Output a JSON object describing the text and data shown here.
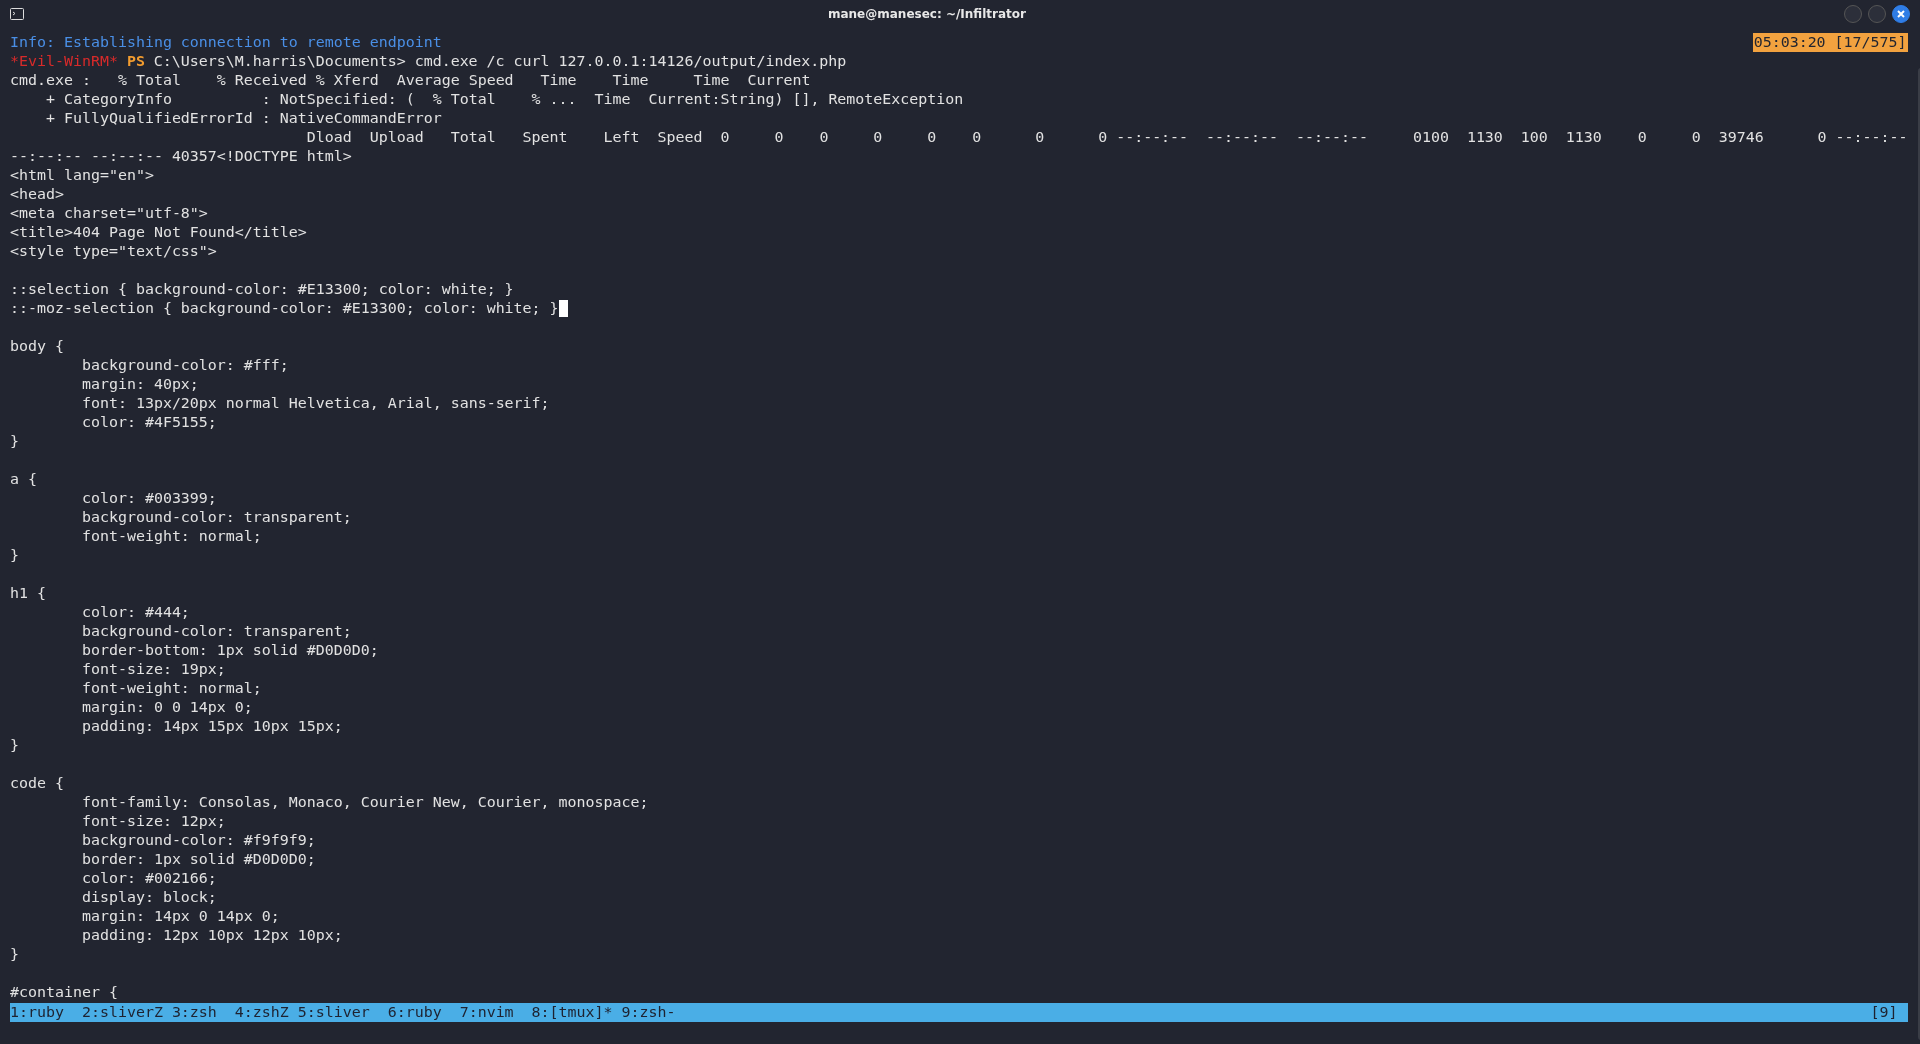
{
  "window": {
    "title": "mane@manesec: ~/Infiltrator"
  },
  "clock": "05:03:20 [17/575]",
  "lines": [
    {
      "kind": "info",
      "text": "Info: Establishing connection to remote endpoint"
    },
    {
      "kind": "prompt",
      "shell": "*Evil-WinRM*",
      "ps": "PS",
      "text": "C:\\Users\\M.harris\\Documents> cmd.exe /c curl 127.0.0.1:14126/output/index.php"
    },
    {
      "kind": "plain",
      "text": "cmd.exe :   % Total    % Received % Xferd  Average Speed   Time    Time     Time  Current"
    },
    {
      "kind": "plain",
      "text": "    + CategoryInfo          : NotSpecified: (  % Total    % ...  Time  Current:String) [], RemoteException"
    },
    {
      "kind": "plain",
      "text": "    + FullyQualifiedErrorId : NativeCommandError"
    },
    {
      "kind": "plain",
      "text": "                                 Dload  Upload   Total   Spent    Left  Speed  0     0    0     0     0    0      0      0 --:--:--  --:--:--  --:--:--     0100  1130  100  1130    0     0  39746      0 --:--:--"
    },
    {
      "kind": "plain",
      "text": "--:--:-- --:--:-- 40357<!DOCTYPE html>"
    },
    {
      "kind": "plain",
      "text": "<html lang=\"en\">"
    },
    {
      "kind": "plain",
      "text": "<head>"
    },
    {
      "kind": "plain",
      "text": "<meta charset=\"utf-8\">"
    },
    {
      "kind": "plain",
      "text": "<title>404 Page Not Found</title>"
    },
    {
      "kind": "plain",
      "text": "<style type=\"text/css\">"
    },
    {
      "kind": "blank"
    },
    {
      "kind": "plain",
      "text": "::selection { background-color: #E13300; color: white; }"
    },
    {
      "kind": "plain",
      "text": "::-moz-selection { background-color: #E13300; color: white; }",
      "cursor": true
    },
    {
      "kind": "blank"
    },
    {
      "kind": "plain",
      "text": "body {"
    },
    {
      "kind": "plain",
      "text": "        background-color: #fff;"
    },
    {
      "kind": "plain",
      "text": "        margin: 40px;"
    },
    {
      "kind": "plain",
      "text": "        font: 13px/20px normal Helvetica, Arial, sans-serif;"
    },
    {
      "kind": "plain",
      "text": "        color: #4F5155;"
    },
    {
      "kind": "plain",
      "text": "}"
    },
    {
      "kind": "blank"
    },
    {
      "kind": "plain",
      "text": "a {"
    },
    {
      "kind": "plain",
      "text": "        color: #003399;"
    },
    {
      "kind": "plain",
      "text": "        background-color: transparent;"
    },
    {
      "kind": "plain",
      "text": "        font-weight: normal;"
    },
    {
      "kind": "plain",
      "text": "}"
    },
    {
      "kind": "blank"
    },
    {
      "kind": "plain",
      "text": "h1 {"
    },
    {
      "kind": "plain",
      "text": "        color: #444;"
    },
    {
      "kind": "plain",
      "text": "        background-color: transparent;"
    },
    {
      "kind": "plain",
      "text": "        border-bottom: 1px solid #D0D0D0;"
    },
    {
      "kind": "plain",
      "text": "        font-size: 19px;"
    },
    {
      "kind": "plain",
      "text": "        font-weight: normal;"
    },
    {
      "kind": "plain",
      "text": "        margin: 0 0 14px 0;"
    },
    {
      "kind": "plain",
      "text": "        padding: 14px 15px 10px 15px;"
    },
    {
      "kind": "plain",
      "text": "}"
    },
    {
      "kind": "blank"
    },
    {
      "kind": "plain",
      "text": "code {"
    },
    {
      "kind": "plain",
      "text": "        font-family: Consolas, Monaco, Courier New, Courier, monospace;"
    },
    {
      "kind": "plain",
      "text": "        font-size: 12px;"
    },
    {
      "kind": "plain",
      "text": "        background-color: #f9f9f9;"
    },
    {
      "kind": "plain",
      "text": "        border: 1px solid #D0D0D0;"
    },
    {
      "kind": "plain",
      "text": "        color: #002166;"
    },
    {
      "kind": "plain",
      "text": "        display: block;"
    },
    {
      "kind": "plain",
      "text": "        margin: 14px 0 14px 0;"
    },
    {
      "kind": "plain",
      "text": "        padding: 12px 10px 12px 10px;"
    },
    {
      "kind": "plain",
      "text": "}"
    },
    {
      "kind": "blank"
    },
    {
      "kind": "plain",
      "text": "#container {"
    }
  ],
  "status_bar": {
    "windows": "1:ruby  2:sliverZ 3:zsh  4:zshZ 5:sliver  6:ruby  7:nvim  8:[tmux]* 9:zsh-",
    "session": "[9]"
  }
}
